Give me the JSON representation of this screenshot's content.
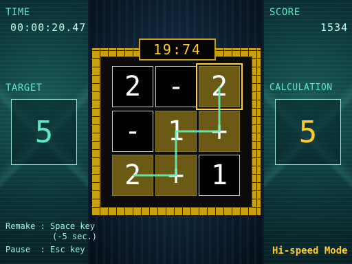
{
  "hud": {
    "time_label": "TIME",
    "time_value": "00:00:20.47",
    "score_label": "SCORE",
    "score_value": "1534",
    "target_label": "TARGET",
    "target_value": "5",
    "calc_label": "CALCULATION",
    "calc_value": "5",
    "countdown": "19:74"
  },
  "help": {
    "remake": "Remake : Space key",
    "remake_note": "(-5 sec.)",
    "pause": "Pause  : Esc key"
  },
  "mode": "Hi-speed Mode",
  "board": {
    "cells": [
      {
        "text": "2",
        "selected": false,
        "current": false
      },
      {
        "text": "-",
        "selected": false,
        "current": false
      },
      {
        "text": "2",
        "selected": true,
        "current": true
      },
      {
        "text": "-",
        "selected": false,
        "current": false
      },
      {
        "text": "1",
        "selected": true,
        "current": false
      },
      {
        "text": "+",
        "selected": true,
        "current": false
      },
      {
        "text": "2",
        "selected": true,
        "current": false
      },
      {
        "text": "+",
        "selected": true,
        "current": false
      },
      {
        "text": "1",
        "selected": false,
        "current": false
      }
    ],
    "path_order": [
      6,
      7,
      4,
      5,
      2
    ]
  },
  "colors": {
    "accent": "#5fe8c8",
    "gold": "#c8a010",
    "yellow": "#ffcb2e",
    "selected_cell": "#6b5a14",
    "path": "#66f0b4"
  }
}
